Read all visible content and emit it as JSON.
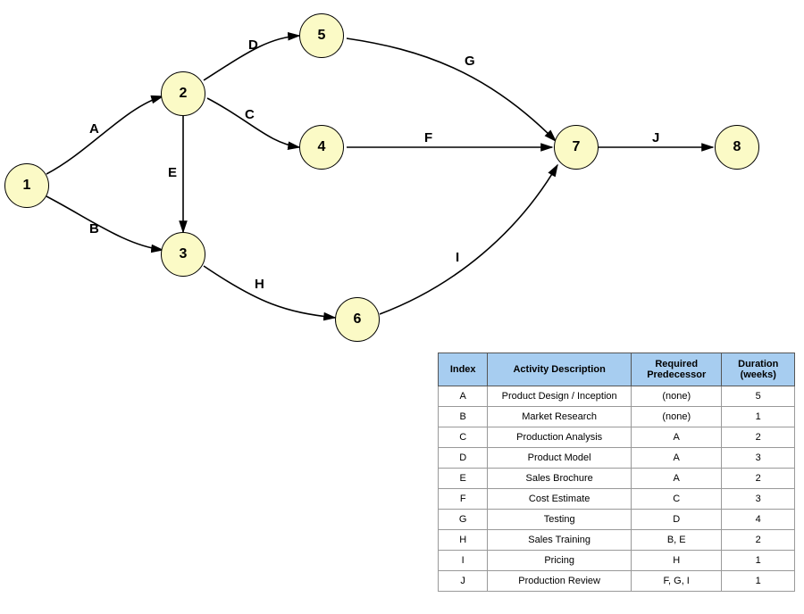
{
  "nodes": {
    "n1": "1",
    "n2": "2",
    "n3": "3",
    "n4": "4",
    "n5": "5",
    "n6": "6",
    "n7": "7",
    "n8": "8"
  },
  "edges": {
    "A": "A",
    "B": "B",
    "C": "C",
    "D": "D",
    "E": "E",
    "F": "F",
    "G": "G",
    "H": "H",
    "I": "I",
    "J": "J"
  },
  "table": {
    "headers": {
      "index": "Index",
      "desc": "Activity Description",
      "pred": "Required Predecessor",
      "dur": "Duration (weeks)"
    },
    "rows": [
      {
        "index": "A",
        "desc": "Product Design / Inception",
        "pred": "(none)",
        "dur": "5"
      },
      {
        "index": "B",
        "desc": "Market Research",
        "pred": "(none)",
        "dur": "1"
      },
      {
        "index": "C",
        "desc": "Production Analysis",
        "pred": "A",
        "dur": "2"
      },
      {
        "index": "D",
        "desc": "Product Model",
        "pred": "A",
        "dur": "3"
      },
      {
        "index": "E",
        "desc": "Sales Brochure",
        "pred": "A",
        "dur": "2"
      },
      {
        "index": "F",
        "desc": "Cost Estimate",
        "pred": "C",
        "dur": "3"
      },
      {
        "index": "G",
        "desc": "Testing",
        "pred": "D",
        "dur": "4"
      },
      {
        "index": "H",
        "desc": "Sales Training",
        "pred": "B, E",
        "dur": "2"
      },
      {
        "index": "I",
        "desc": "Pricing",
        "pred": "H",
        "dur": "1"
      },
      {
        "index": "J",
        "desc": "Production Review",
        "pred": "F, G, I",
        "dur": "1"
      }
    ]
  },
  "chart_data": {
    "type": "network-diagram",
    "nodes": [
      1,
      2,
      3,
      4,
      5,
      6,
      7,
      8
    ],
    "edges": [
      {
        "id": "A",
        "from": 1,
        "to": 2,
        "desc": "Product Design / Inception",
        "pred": null,
        "duration_weeks": 5
      },
      {
        "id": "B",
        "from": 1,
        "to": 3,
        "desc": "Market Research",
        "pred": null,
        "duration_weeks": 1
      },
      {
        "id": "C",
        "from": 2,
        "to": 4,
        "desc": "Production Analysis",
        "pred": [
          "A"
        ],
        "duration_weeks": 2
      },
      {
        "id": "D",
        "from": 2,
        "to": 5,
        "desc": "Product Model",
        "pred": [
          "A"
        ],
        "duration_weeks": 3
      },
      {
        "id": "E",
        "from": 2,
        "to": 3,
        "desc": "Sales Brochure",
        "pred": [
          "A"
        ],
        "duration_weeks": 2
      },
      {
        "id": "F",
        "from": 4,
        "to": 7,
        "desc": "Cost Estimate",
        "pred": [
          "C"
        ],
        "duration_weeks": 3
      },
      {
        "id": "G",
        "from": 5,
        "to": 7,
        "desc": "Testing",
        "pred": [
          "D"
        ],
        "duration_weeks": 4
      },
      {
        "id": "H",
        "from": 3,
        "to": 6,
        "desc": "Sales Training",
        "pred": [
          "B",
          "E"
        ],
        "duration_weeks": 2
      },
      {
        "id": "I",
        "from": 6,
        "to": 7,
        "desc": "Pricing",
        "pred": [
          "H"
        ],
        "duration_weeks": 1
      },
      {
        "id": "J",
        "from": 7,
        "to": 8,
        "desc": "Production Review",
        "pred": [
          "F",
          "G",
          "I"
        ],
        "duration_weeks": 1
      }
    ]
  }
}
